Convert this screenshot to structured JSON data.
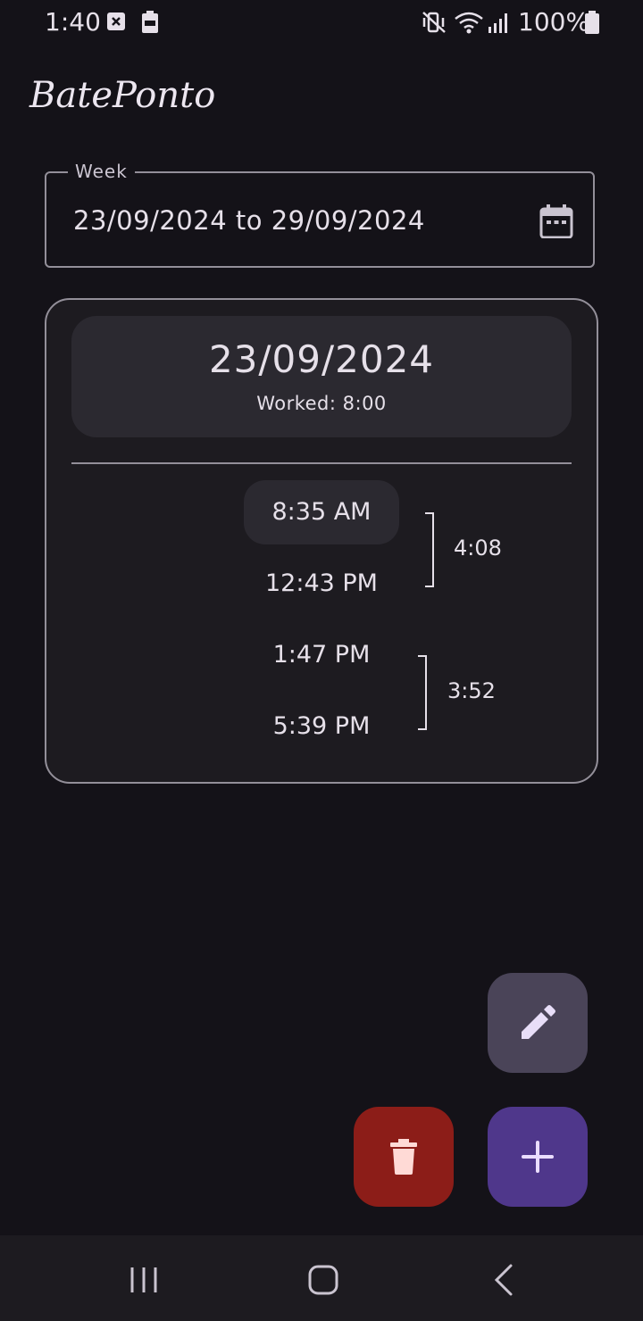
{
  "status_bar": {
    "time": "1:40",
    "battery_text": "100%",
    "icons": [
      "close-box-icon",
      "battery-saver-icon",
      "mute-vibrate-icon",
      "wifi-icon",
      "signal-icon",
      "battery-icon"
    ]
  },
  "app": {
    "title": "BatePonto"
  },
  "week": {
    "label": "Week",
    "value": "23/09/2024 to 29/09/2024",
    "icon": "calendar-icon"
  },
  "day": {
    "date": "23/09/2024",
    "worked": "Worked: 8:00",
    "entries": [
      {
        "in": "8:35 AM",
        "out": "12:43 PM",
        "duration": "4:08"
      },
      {
        "in": "1:47 PM",
        "out": "5:39 PM",
        "duration": "3:52"
      }
    ]
  },
  "fabs": {
    "edit_icon": "pencil-icon",
    "delete_icon": "trash-icon",
    "add_icon": "plus-icon"
  },
  "colors": {
    "background": "#141218",
    "delete_fab": "#8c1d18",
    "add_fab": "#4f378b",
    "edit_fab": "#4a4458"
  }
}
